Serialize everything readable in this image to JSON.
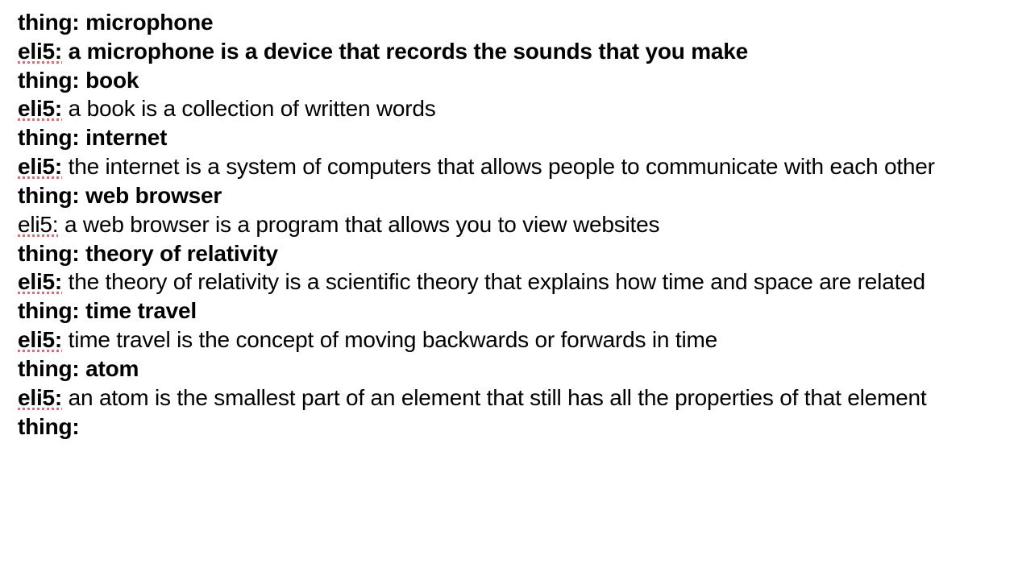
{
  "entries": [
    {
      "label": "thing:",
      "value": "microphone",
      "labelBold": true,
      "valueBold": true,
      "spellcheck": false
    },
    {
      "label": "eli5:",
      "value": "a microphone is a device that records the sounds that you make",
      "labelBold": true,
      "valueBold": true,
      "spellcheck": true
    },
    {
      "label": "thing:",
      "value": "book",
      "labelBold": true,
      "valueBold": true,
      "spellcheck": false
    },
    {
      "label": "eli5:",
      "value": "a book is a collection of written words",
      "labelBold": true,
      "valueBold": false,
      "spellcheck": true
    },
    {
      "label": "thing:",
      "value": "internet",
      "labelBold": true,
      "valueBold": true,
      "spellcheck": false
    },
    {
      "label": "eli5:",
      "value": "the internet is a system of computers that allows people to communicate with each other",
      "labelBold": true,
      "valueBold": false,
      "spellcheck": true
    },
    {
      "label": "thing:",
      "value": "web browser",
      "labelBold": true,
      "valueBold": true,
      "spellcheck": false
    },
    {
      "label": "eli5:",
      "value": "a web browser is a program that allows you to view websites",
      "labelBold": false,
      "valueBold": false,
      "spellcheck": true
    },
    {
      "label": "thing:",
      "value": "theory of relativity",
      "labelBold": true,
      "valueBold": true,
      "spellcheck": false
    },
    {
      "label": "eli5:",
      "value": "the theory of relativity is a scientific theory that explains how time and space are related",
      "labelBold": true,
      "valueBold": false,
      "spellcheck": true
    },
    {
      "label": "thing:",
      "value": "time travel",
      "labelBold": true,
      "valueBold": true,
      "spellcheck": false
    },
    {
      "label": "eli5:",
      "value": "time travel is the concept of moving backwards or forwards in time",
      "labelBold": true,
      "valueBold": false,
      "spellcheck": true
    },
    {
      "label": "thing:",
      "value": "atom",
      "labelBold": true,
      "valueBold": true,
      "spellcheck": false
    },
    {
      "label": "eli5:",
      "value": "an atom is the smallest part of an element that still has all the properties of that element",
      "labelBold": true,
      "valueBold": false,
      "spellcheck": true
    },
    {
      "label": "thing:",
      "value": "",
      "labelBold": true,
      "valueBold": true,
      "spellcheck": false
    }
  ]
}
